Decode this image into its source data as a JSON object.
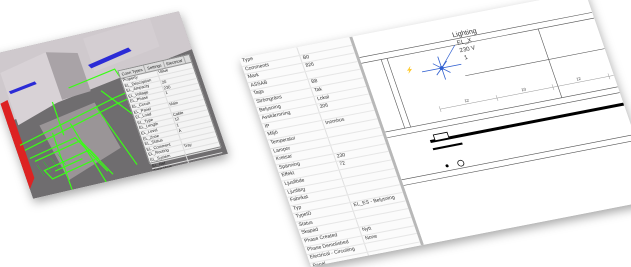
{
  "left_panel": {
    "dialog_tabs": [
      "Conn Types",
      "Settings",
      "Electrical"
    ],
    "dialog_rows": [
      [
        "Property",
        "Value"
      ],
      [
        "EL_Description",
        ""
      ],
      [
        "EL_Ampacity",
        "20"
      ],
      [
        "EL_Voltage",
        "230"
      ],
      [
        "EL_Phase",
        "1"
      ],
      [
        "EL_Circuit",
        ""
      ],
      [
        "EL_Panel",
        "Main"
      ],
      [
        "EL_Load",
        ""
      ],
      [
        "EL_Type",
        "Cable"
      ],
      [
        "EL_Length",
        "12"
      ],
      [
        "EL_Level",
        "1"
      ],
      [
        "EL_Zone",
        "A"
      ],
      [
        "EL_Status",
        ""
      ],
      [
        "EL_Comment",
        ""
      ],
      [
        "EL_Routing",
        "Tray"
      ],
      [
        "EL_System",
        ""
      ],
      [
        "EL_Ref",
        ""
      ],
      [
        "Type Mark",
        ""
      ],
      [
        "Comments",
        ""
      ]
    ]
  },
  "right_panel": {
    "properties": [
      [
        "Type",
        ""
      ],
      [
        "Comments",
        "B0"
      ],
      [
        "Mark",
        "826"
      ],
      [
        "ASSAB",
        ""
      ],
      [
        "Tags",
        "B8"
      ],
      [
        "Strömgräns",
        "Tak"
      ],
      [
        "Belysning",
        "Lokal"
      ],
      [
        "Avskärmning",
        "206"
      ],
      [
        "IP",
        ""
      ],
      [
        "Miljö",
        "Inomhus"
      ],
      [
        "Temperatur",
        ""
      ],
      [
        "Lampor",
        ""
      ],
      [
        "Kretsar",
        ""
      ],
      [
        "Spänning",
        "230"
      ],
      [
        "Effekt",
        "72"
      ],
      [
        "Ljusflöde",
        ""
      ],
      [
        "Ljusfärg",
        ""
      ],
      [
        "Fabrikat",
        ""
      ],
      [
        "Typ",
        ""
      ],
      [
        "TypeID",
        "EL_ES - Belysning"
      ],
      [
        "Status",
        ""
      ],
      [
        "Skapad",
        ""
      ],
      [
        "Phase Created",
        "Nytt"
      ],
      [
        "Phase Demolished",
        "None"
      ],
      [
        "Electrical - Circuiting",
        ""
      ],
      [
        "Panel",
        ""
      ]
    ],
    "drawing_labels": {
      "fixture": "Lighting",
      "circuit": "EL_X",
      "voltage": "230 V",
      "count": "1",
      "dims": [
        "12",
        "10",
        "12"
      ]
    }
  },
  "colors": {
    "cable_tray": "#39ff14",
    "wall": "#c8c2c6",
    "floor": "#6f6d6f",
    "beam_blue": "#2b2bd6",
    "accent_red": "#d22"
  }
}
